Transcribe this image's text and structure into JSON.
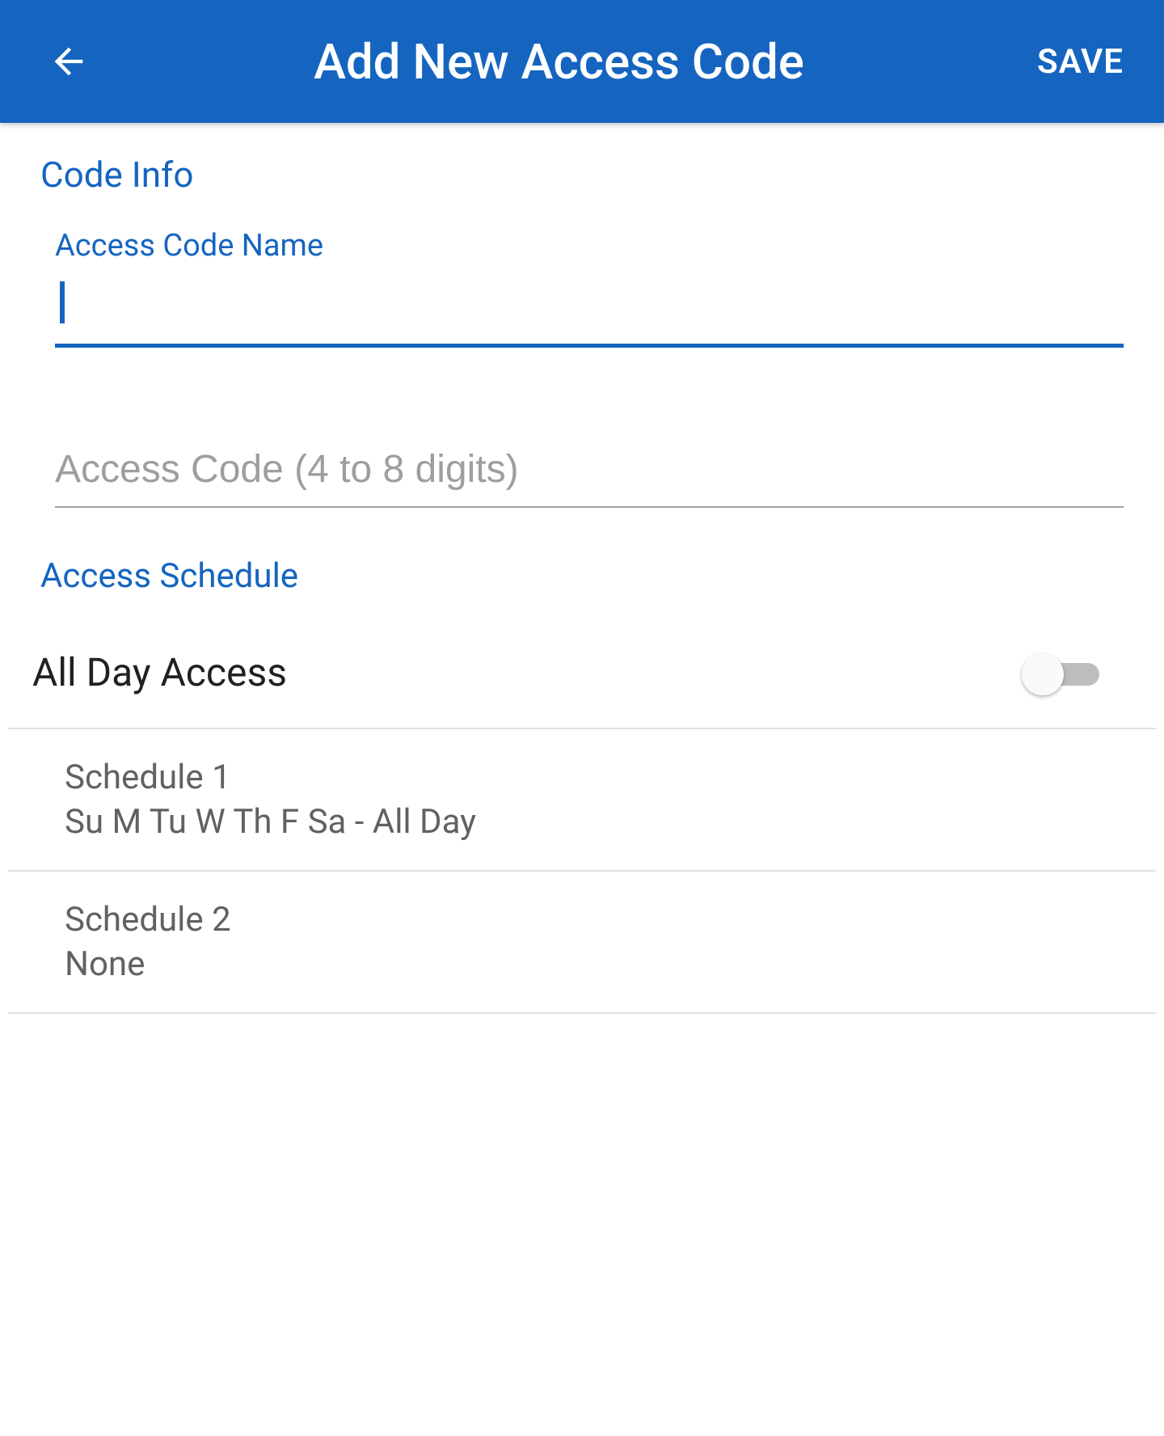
{
  "appbar": {
    "title": "Add New Access Code",
    "save_label": "SAVE"
  },
  "code_info": {
    "header": "Code Info",
    "name_label": "Access Code Name",
    "name_value": "",
    "code_placeholder": "Access Code (4 to 8 digits)",
    "code_value": ""
  },
  "schedule": {
    "header": "Access Schedule",
    "all_day_label": "All Day Access",
    "all_day_on": false,
    "items": [
      {
        "title": "Schedule 1",
        "detail": "Su M Tu W Th F Sa - All Day"
      },
      {
        "title": "Schedule 2",
        "detail": "None"
      }
    ]
  }
}
